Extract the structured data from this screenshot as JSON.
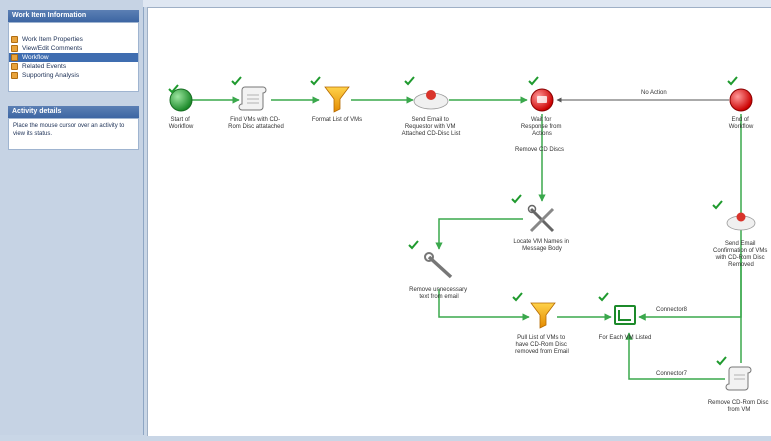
{
  "sidebar": {
    "header_work_item": "Work Item Information",
    "nav_items": [
      {
        "label": "Work Item Properties",
        "selected": false
      },
      {
        "label": "View/Edit Comments",
        "selected": false
      },
      {
        "label": "Workflow",
        "selected": true
      },
      {
        "label": "Related Events",
        "selected": false
      },
      {
        "label": "Supporting Analysis",
        "selected": false
      }
    ],
    "header_activity": "Activity details",
    "activity_text": "Place the mouse cursor over an activity to view its status."
  },
  "workflow": {
    "nodes": {
      "start": [
        "Start of",
        "Workflow"
      ],
      "find_vms": [
        "Find VMs with CD-",
        "Rom Disc attatached"
      ],
      "format_list": [
        "Format List of VMs"
      ],
      "send_email": [
        "Send Email to",
        "Requestor with VM",
        "Attached CD-Disc List"
      ],
      "wait_response": [
        "Wait for",
        "Response from",
        "Actions"
      ],
      "end": [
        "End of",
        "Workflow"
      ],
      "locate_vm": [
        "Locate VM Names in",
        "Message Body"
      ],
      "remove_text": [
        "Remove unnecessary",
        "text from email"
      ],
      "pull_list": [
        "Pull List of VMs to",
        "have CD-Rom Disc",
        "removed from Email"
      ],
      "for_each": [
        "For Each VM Listed"
      ],
      "send_confirm": [
        "Send Email",
        "Confirmation of VMs",
        "with CD-Rom Disc",
        "Removed"
      ],
      "remove_cd": [
        "Remove CD-Rom Disc",
        "from VM"
      ]
    },
    "connectors": {
      "no_action": "No Action",
      "remove_cd_discs": "Remove CD Discs",
      "connector8": "Connector8",
      "connector7": "Connector7"
    }
  },
  "colors": {
    "line": "#3aa84c",
    "check": "#1f9a2e",
    "header": "#3d66a3",
    "selected": "#3f6db0"
  }
}
